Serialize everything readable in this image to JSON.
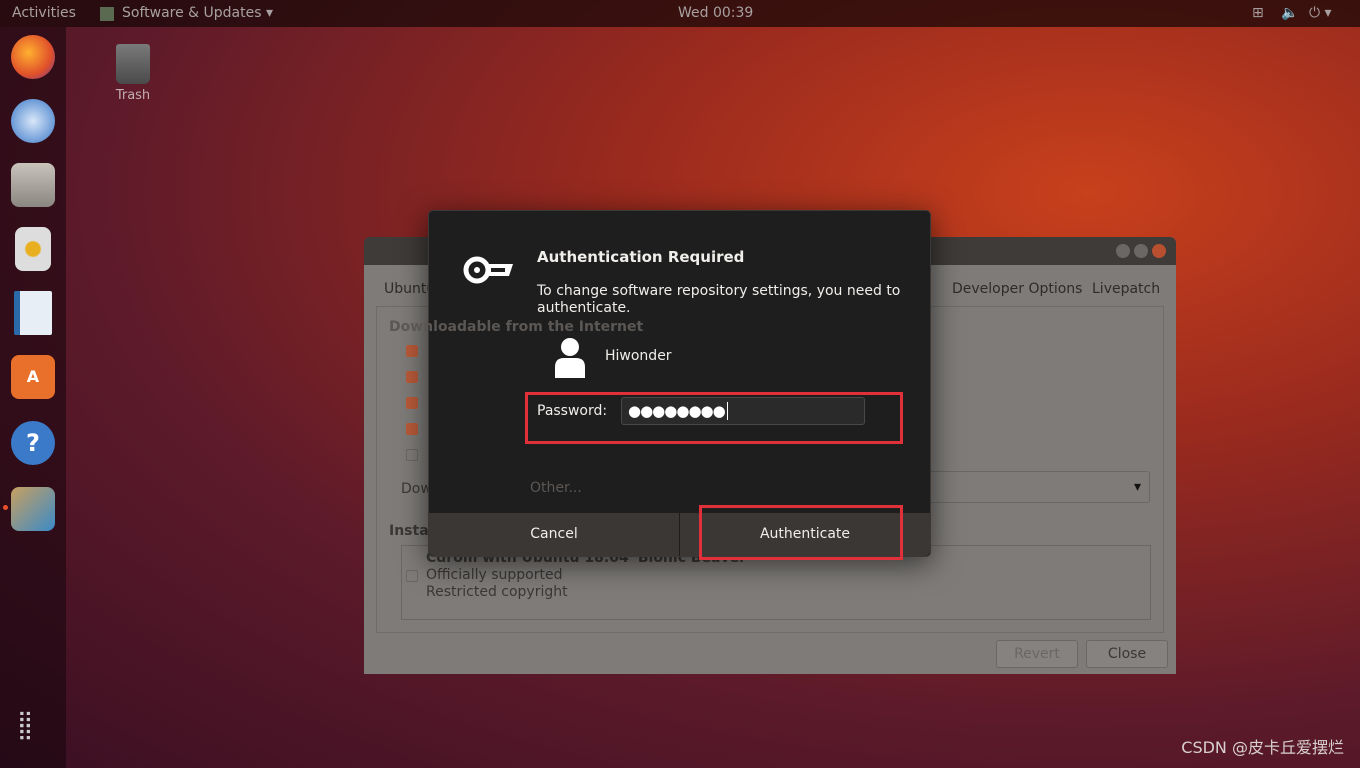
{
  "topbar": {
    "activities": "Activities",
    "app_menu": "Software & Updates ▾",
    "clock": "Wed 00:39",
    "tray_icons": [
      "network-icon",
      "volume-icon",
      "power-icon"
    ]
  },
  "dock": {
    "apps": [
      "firefox-icon",
      "thunderbird-icon",
      "files-icon",
      "rhythmbox-icon",
      "libreoffice-writer-icon",
      "ubuntu-software-icon",
      "help-icon",
      "software-updates-icon"
    ],
    "show_apps": "grid-icon"
  },
  "desktop": {
    "trash_label": "Trash"
  },
  "background_window": {
    "title": "Software & Updates",
    "tabs": [
      "Ubuntu Software",
      "Developer Options",
      "Livepatch"
    ],
    "section_downloadable": "Downloadable from the Internet",
    "section_installable": "Installable from CD-ROM/DVD",
    "options": [
      {
        "checked": true
      },
      {
        "checked": true
      },
      {
        "checked": true
      },
      {
        "checked": true
      },
      {
        "checked": false
      }
    ],
    "download_from_label": "Download from:",
    "download_from_value": "Other...",
    "cdrom": {
      "title": "Cdrom with Ubuntu 18.04 'Bionic Beaver'",
      "line1": "Officially supported",
      "line2": "Restricted copyright",
      "checked": false
    },
    "revert": "Revert",
    "close": "Close"
  },
  "dialog": {
    "title": "Authentication Required",
    "message": "To change software repository settings, you need to authenticate.",
    "user": "Hiwonder",
    "password_label": "Password:",
    "password_value": "●●●●●●●●",
    "cancel": "Cancel",
    "authenticate": "Authenticate",
    "highlight_color": "#e0303a"
  },
  "watermark": "CSDN @皮卡丘爱摆烂"
}
